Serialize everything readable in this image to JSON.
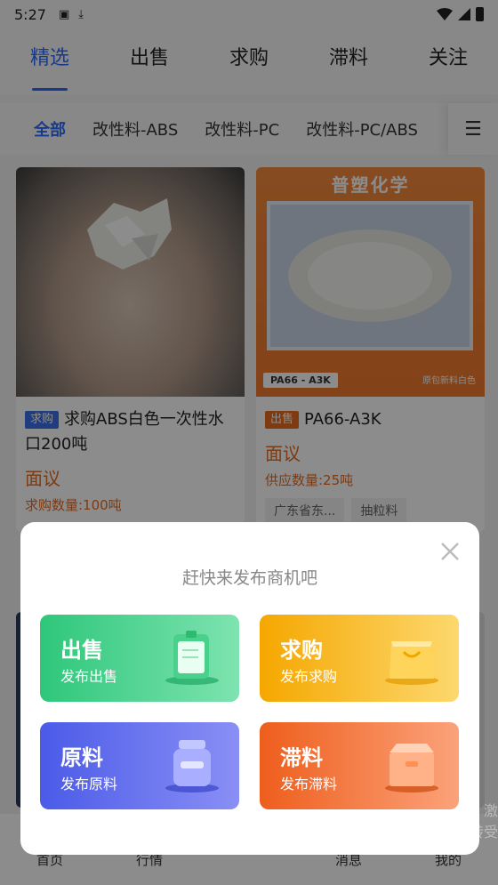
{
  "status_bar": {
    "time": "5:27"
  },
  "main_tabs": [
    {
      "label": "精选",
      "active": true
    },
    {
      "label": "出售"
    },
    {
      "label": "求购"
    },
    {
      "label": "滞料"
    },
    {
      "label": "关注"
    }
  ],
  "sub_tabs": [
    {
      "label": "全部",
      "active": true
    },
    {
      "label": "改性料-ABS"
    },
    {
      "label": "改性料-PC"
    },
    {
      "label": "改性料-PC/ABS"
    }
  ],
  "cards": [
    {
      "tag": "求购",
      "title": "求购ABS白色一次性水口200吨",
      "price": "面议",
      "qty": "求购数量:100吨"
    },
    {
      "tag": "出售",
      "title": "PA66-A3K",
      "price": "面议",
      "qty": "供应数量:25吨",
      "image_brand": "普塑化学",
      "image_label": "PA66 - A3K",
      "image_label2": "原包新料白色",
      "chips": [
        "广东省东...",
        "抽粒料"
      ]
    }
  ],
  "bottom_nav": [
    "首页",
    "行情",
    "",
    "消息",
    "我的"
  ],
  "peek_text": [
    "激",
    "转受"
  ],
  "dialog": {
    "title": "赶快来发布商机吧",
    "options": [
      {
        "title": "出售",
        "subtitle": "发布出售",
        "icon": "clipboard-icon"
      },
      {
        "title": "求购",
        "subtitle": "发布求购",
        "icon": "shopping-bag-icon"
      },
      {
        "title": "原料",
        "subtitle": "发布原料",
        "icon": "jar-icon"
      },
      {
        "title": "滞料",
        "subtitle": "发布滞料",
        "icon": "box-icon"
      }
    ]
  },
  "colors": {
    "accent": "#2b6bff",
    "price": "#e56a1e",
    "sell_green": "#2ec77a",
    "buy_orange": "#f5a700",
    "raw_blue": "#4b5be8",
    "stock_red": "#ee5e1c"
  }
}
